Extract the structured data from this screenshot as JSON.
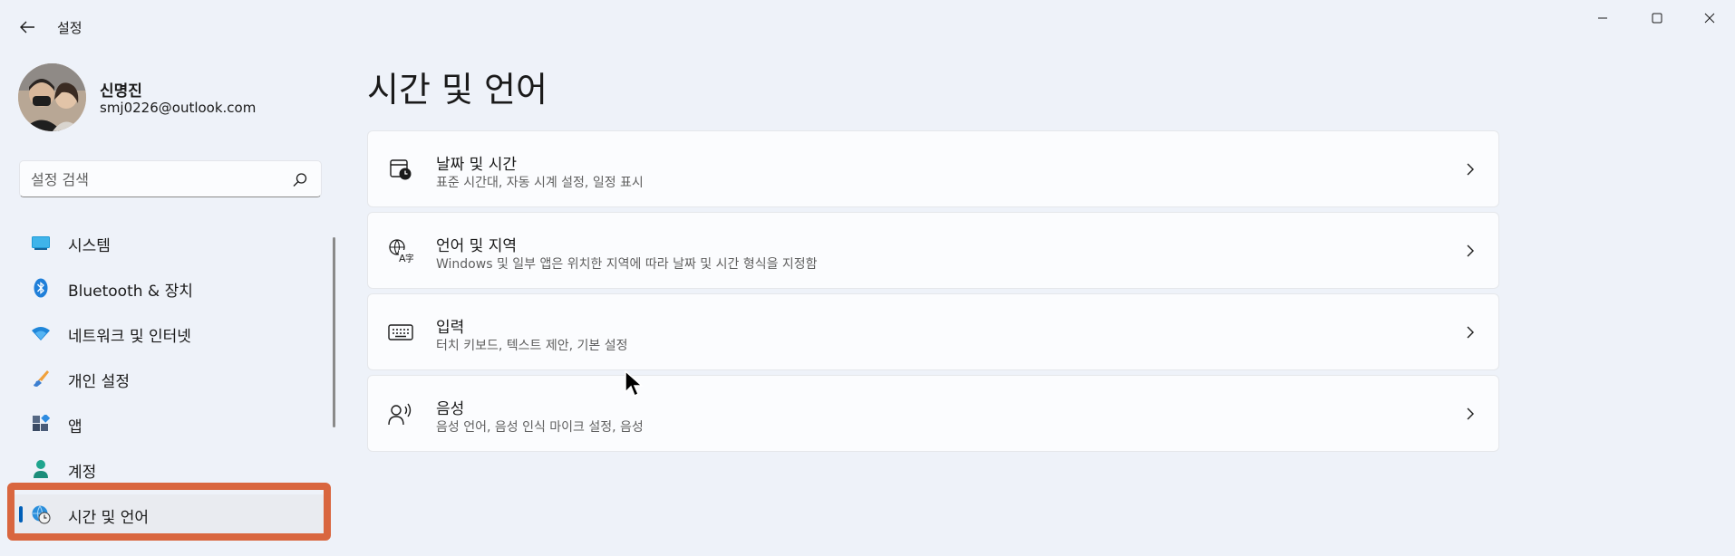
{
  "window": {
    "title": "설정",
    "controls": [
      "minimize-icon",
      "maximize-icon",
      "close-icon"
    ]
  },
  "profile": {
    "name": "신명진",
    "email": "smj0226@outlook.com"
  },
  "search": {
    "placeholder": "설정 검색",
    "value": ""
  },
  "sidebar": {
    "items": [
      {
        "label": "시스템",
        "icon": "monitor-icon",
        "active": false
      },
      {
        "label": "Bluetooth & 장치",
        "icon": "bluetooth-icon",
        "active": false
      },
      {
        "label": "네트워크 및 인터넷",
        "icon": "wifi-icon",
        "active": false
      },
      {
        "label": "개인 설정",
        "icon": "brush-icon",
        "active": false
      },
      {
        "label": "앱",
        "icon": "apps-icon",
        "active": false
      },
      {
        "label": "계정",
        "icon": "person-icon",
        "active": false
      },
      {
        "label": "시간 및 언어",
        "icon": "globe-clock-icon",
        "active": true
      }
    ]
  },
  "main": {
    "title": "시간 및 언어",
    "cards": [
      {
        "title": "날짜 및 시간",
        "description": "표준 시간대, 자동 시계 설정, 일정 표시",
        "icon": "calendar-clock-icon"
      },
      {
        "title": "언어 및 지역",
        "description": "Windows 및 일부 앱은 위치한 지역에 따라 날짜 및 시간 형식을 지정함",
        "icon": "language-globe-icon"
      },
      {
        "title": "입력",
        "description": "터치 키보드, 텍스트 제안, 기본 설정",
        "icon": "keyboard-icon"
      },
      {
        "title": "음성",
        "description": "음성 언어, 음성 인식 마이크 설정, 음성",
        "icon": "speech-icon"
      }
    ]
  },
  "colors": {
    "accent": "#005fb8",
    "highlight": "#d9663f",
    "background": "#eef2f9",
    "card": "#fbfcfe"
  }
}
